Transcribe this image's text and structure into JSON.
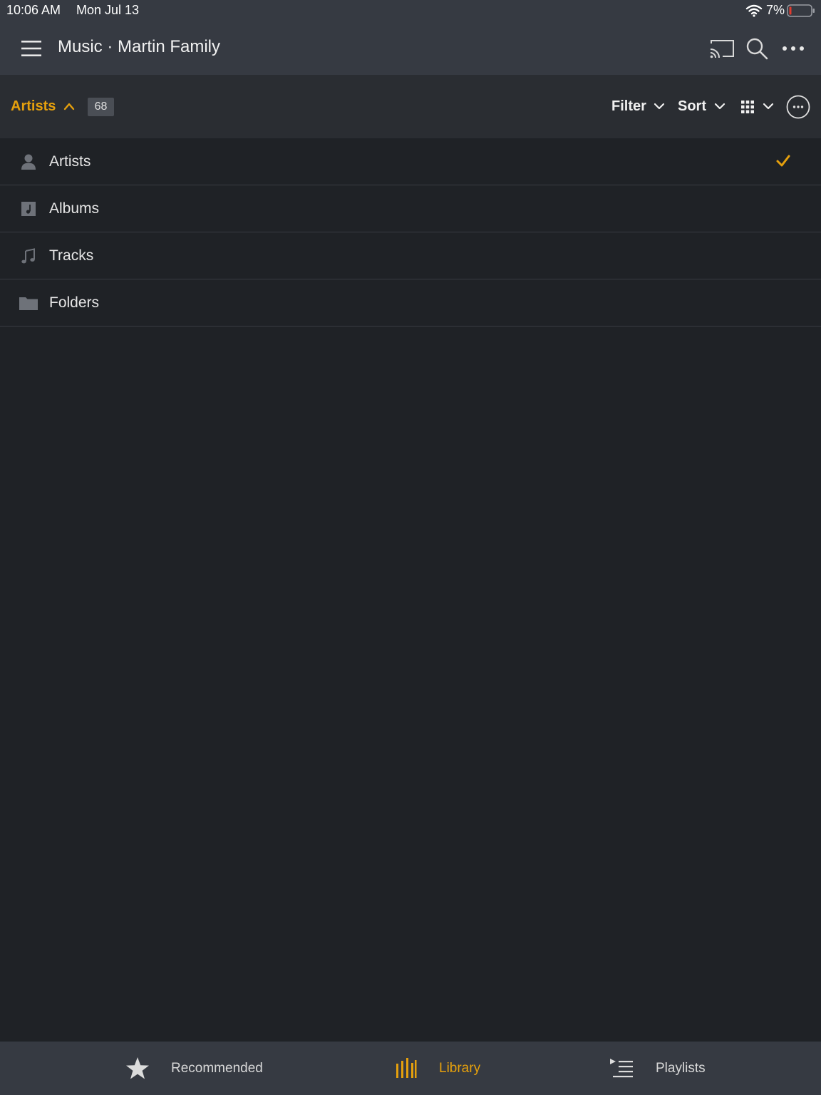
{
  "status_bar": {
    "time": "10:06 AM",
    "date": "Mon Jul 13",
    "battery_percent": "7%",
    "icons": [
      "wifi-icon",
      "battery-low-icon"
    ]
  },
  "header": {
    "title": "Music · Martin Family",
    "icons": [
      "hamburger-menu-icon",
      "cast-icon",
      "search-icon",
      "more-dots-icon"
    ]
  },
  "toolbar": {
    "section_label": "Artists",
    "count": "68",
    "filter_label": "Filter",
    "sort_label": "Sort",
    "icons": [
      "chevron-up-icon",
      "chevron-down-icon",
      "grid-view-icon",
      "options-circle-icon"
    ]
  },
  "library_types": [
    {
      "label": "Artists",
      "icon": "person-icon",
      "selected": true
    },
    {
      "label": "Albums",
      "icon": "album-icon",
      "selected": false
    },
    {
      "label": "Tracks",
      "icon": "music-note-icon",
      "selected": false
    },
    {
      "label": "Folders",
      "icon": "folder-icon",
      "selected": false
    }
  ],
  "tabs": [
    {
      "label": "Recommended",
      "icon": "star-icon",
      "active": false
    },
    {
      "label": "Library",
      "icon": "library-bars-icon",
      "active": true
    },
    {
      "label": "Playlists",
      "icon": "playlist-icon",
      "active": false
    }
  ],
  "colors": {
    "accent": "#e5a00d",
    "background": "#1f2226",
    "header": "#363a42",
    "toolbar": "#2a2d32"
  }
}
